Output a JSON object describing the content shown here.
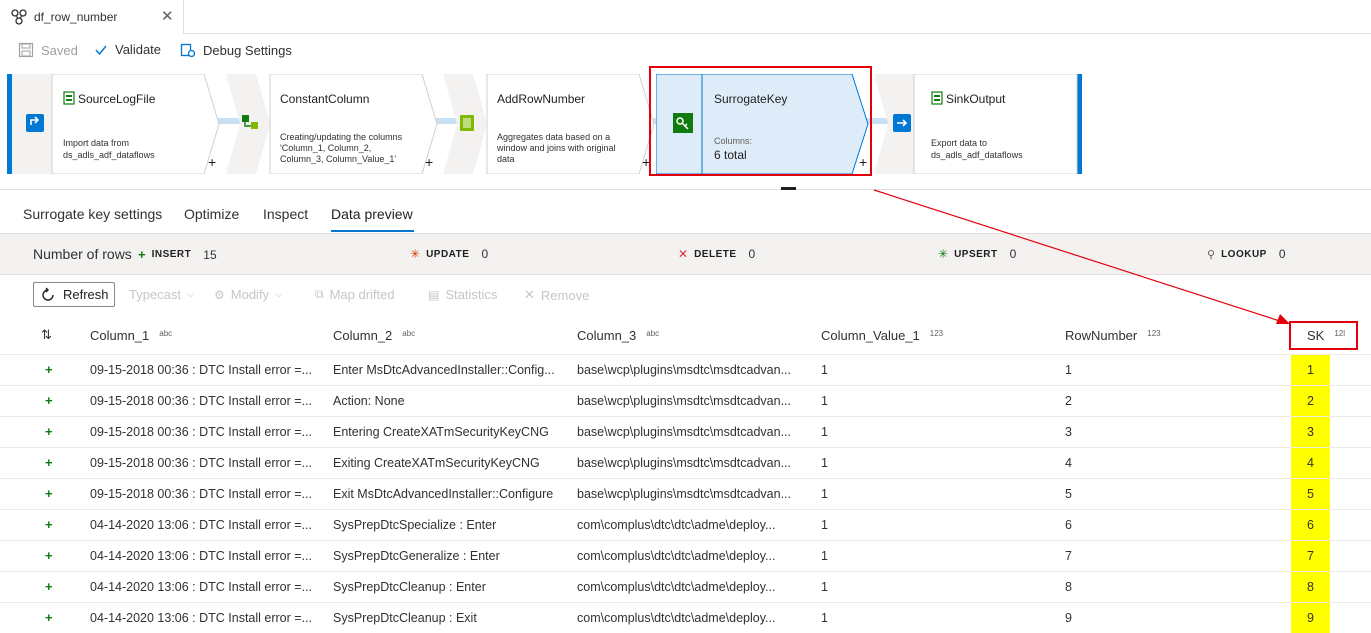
{
  "tab": {
    "title": "df_row_number",
    "close": "✕"
  },
  "toolbar": {
    "saved_label": "Saved",
    "validate_label": "Validate",
    "debug_label": "Debug Settings"
  },
  "flow": {
    "nodes": [
      {
        "title": "SourceLogFile",
        "desc1": "Import data from",
        "desc2": "ds_adls_adf_dataflows",
        "desc3": ""
      },
      {
        "title": "ConstantColumn",
        "desc1": "Creating/updating the columns",
        "desc2": "'Column_1, Column_2,",
        "desc3": "Column_3, Column_Value_1'"
      },
      {
        "title": "AddRowNumber",
        "desc1": "Aggregates data based on a",
        "desc2": "window and joins with original",
        "desc3": "data"
      },
      {
        "title": "SurrogateKey",
        "desc1": "Columns:",
        "desc2": "6 total",
        "desc3": ""
      },
      {
        "title": "SinkOutput",
        "desc1": "Export data to",
        "desc2": "ds_adls_adf_dataflows",
        "desc3": ""
      }
    ],
    "plus": "+"
  },
  "panel_tabs": [
    "Surrogate key settings",
    "Optimize",
    "Inspect",
    "Data preview"
  ],
  "stats": {
    "label": "Number of rows",
    "insert": {
      "name": "INSERT",
      "value": "15"
    },
    "update": {
      "name": "UPDATE",
      "value": "0"
    },
    "delete": {
      "name": "DELETE",
      "value": "0"
    },
    "upsert": {
      "name": "UPSERT",
      "value": "0"
    },
    "lookup": {
      "name": "LOOKUP",
      "value": "0"
    }
  },
  "actions": {
    "refresh": "Refresh",
    "typecast": "Typecast",
    "modify": "Modify",
    "map_drifted": "Map drifted",
    "statistics": "Statistics",
    "remove": "Remove"
  },
  "grid": {
    "sort_icon": "⇅",
    "columns": [
      {
        "name": "Column_1",
        "type": "abc"
      },
      {
        "name": "Column_2",
        "type": "abc"
      },
      {
        "name": "Column_3",
        "type": "abc"
      },
      {
        "name": "Column_Value_1",
        "type": "123"
      },
      {
        "name": "RowNumber",
        "type": "123"
      },
      {
        "name": "SK",
        "type": "12l"
      }
    ],
    "rows": [
      [
        "09-15-2018 00:36 : DTC Install error =...",
        "Enter MsDtcAdvancedInstaller::Config...",
        "base\\wcp\\plugins\\msdtc\\msdtcadvan...",
        "1",
        "1",
        "1"
      ],
      [
        "09-15-2018 00:36 : DTC Install error =...",
        "Action: None",
        "base\\wcp\\plugins\\msdtc\\msdtcadvan...",
        "1",
        "2",
        "2"
      ],
      [
        "09-15-2018 00:36 : DTC Install error =...",
        "Entering CreateXATmSecurityKeyCNG",
        "base\\wcp\\plugins\\msdtc\\msdtcadvan...",
        "1",
        "3",
        "3"
      ],
      [
        "09-15-2018 00:36 : DTC Install error =...",
        "Exiting CreateXATmSecurityKeyCNG",
        "base\\wcp\\plugins\\msdtc\\msdtcadvan...",
        "1",
        "4",
        "4"
      ],
      [
        "09-15-2018 00:36 : DTC Install error =...",
        "Exit MsDtcAdvancedInstaller::Configure",
        "base\\wcp\\plugins\\msdtc\\msdtcadvan...",
        "1",
        "5",
        "5"
      ],
      [
        "04-14-2020 13:06 : DTC Install error =...",
        "SysPrepDtcSpecialize : Enter",
        "com\\complus\\dtc\\dtc\\adme\\deploy...",
        "1",
        "6",
        "6"
      ],
      [
        "04-14-2020 13:06 : DTC Install error =...",
        "SysPrepDtcGeneralize : Enter",
        "com\\complus\\dtc\\dtc\\adme\\deploy...",
        "1",
        "7",
        "7"
      ],
      [
        "04-14-2020 13:06 : DTC Install error =...",
        "SysPrepDtcCleanup : Enter",
        "com\\complus\\dtc\\dtc\\adme\\deploy...",
        "1",
        "8",
        "8"
      ],
      [
        "04-14-2020 13:06 : DTC Install error =...",
        "SysPrepDtcCleanup : Exit",
        "com\\complus\\dtc\\dtc\\adme\\deploy...",
        "1",
        "9",
        "9"
      ]
    ]
  },
  "colors": {
    "accent": "#0078d4",
    "highlight": "#ffff00",
    "annotation": "#e3000b",
    "insert": "#107c10"
  }
}
